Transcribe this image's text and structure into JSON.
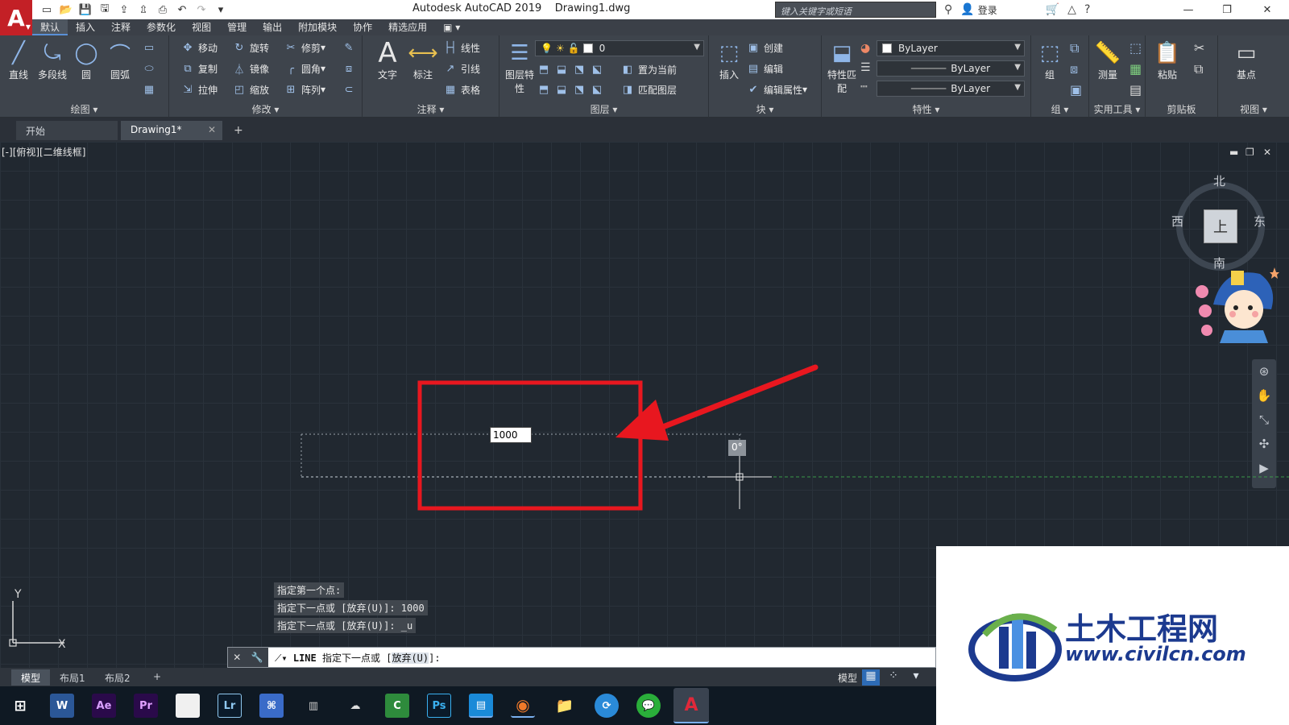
{
  "app": {
    "title": "Autodesk AutoCAD 2019",
    "document": "Drawing1.dwg",
    "logo_letter": "A",
    "search_placeholder": "键入关键字或短语",
    "login_label": "登录"
  },
  "menu_tabs": [
    "默认",
    "插入",
    "注释",
    "参数化",
    "视图",
    "管理",
    "输出",
    "附加模块",
    "协作",
    "精选应用"
  ],
  "ribbon": {
    "draw": {
      "title": "绘图",
      "tools": [
        "直线",
        "多段线",
        "圆",
        "圆弧"
      ]
    },
    "modify": {
      "title": "修改",
      "tools": [
        "移动",
        "旋转",
        "修剪",
        "复制",
        "镜像",
        "圆角",
        "拉伸",
        "缩放",
        "阵列"
      ]
    },
    "annotation": {
      "title": "注释",
      "big_tools": [
        "文字",
        "标注"
      ],
      "small_tools": [
        "线性",
        "引线",
        "表格"
      ]
    },
    "layers": {
      "title": "图层",
      "big_tool": "图层特性",
      "current_layer": "0",
      "tools": [
        "置为当前",
        "匹配图层"
      ]
    },
    "block": {
      "title": "块",
      "big_tool": "插入",
      "tools": [
        "创建",
        "编辑",
        "编辑属性"
      ]
    },
    "properties": {
      "title": "特性",
      "big_tool": "特性匹配",
      "color": "ByLayer",
      "linetype": "ByLayer",
      "lineweight": "ByLayer"
    },
    "groups": {
      "title": "组",
      "big_tool": "组"
    },
    "utilities": {
      "title": "实用工具",
      "big_tool": "测量"
    },
    "clipboard": {
      "title": "剪贴板",
      "big_tool": "粘贴"
    },
    "view": {
      "title": "视图",
      "big_tool": "基点"
    }
  },
  "file_tabs": [
    {
      "label": "开始"
    },
    {
      "label": "Drawing1*"
    }
  ],
  "viewport": {
    "label": "[-][俯视][二维线框]",
    "viewcube": {
      "face": "上",
      "north": "北",
      "south": "南",
      "east": "东",
      "west": "西"
    }
  },
  "dynamic_input": {
    "value": "1000"
  },
  "angle_tooltip": "0°",
  "command_history": [
    "指定第一个点:",
    "指定下一点或 [放弃(U)]: 1000",
    "指定下一点或 [放弃(U)]: _u"
  ],
  "command_line": {
    "command": "LINE",
    "prompt": "指定下一点或 [",
    "option": "放弃(U)",
    "suffix": "]:"
  },
  "ucs": {
    "x": "X",
    "y": "Y"
  },
  "layout_tabs": [
    "模型",
    "布局1",
    "布局2"
  ],
  "status": {
    "model_label": "模型"
  },
  "taskbar_apps": [
    "W",
    "Ae",
    "Pr",
    "",
    "Lr",
    "",
    "",
    "",
    "",
    "Ps",
    "",
    "",
    "",
    "",
    "",
    "A"
  ],
  "watermark": {
    "title": "土木工程网",
    "url": "www.civilcn.com"
  },
  "colors": {
    "annotation_red": "#e8171f",
    "canvas_bg": "#212830",
    "autocad_red": "#c32026",
    "accent_blue": "#2d6bb5"
  }
}
